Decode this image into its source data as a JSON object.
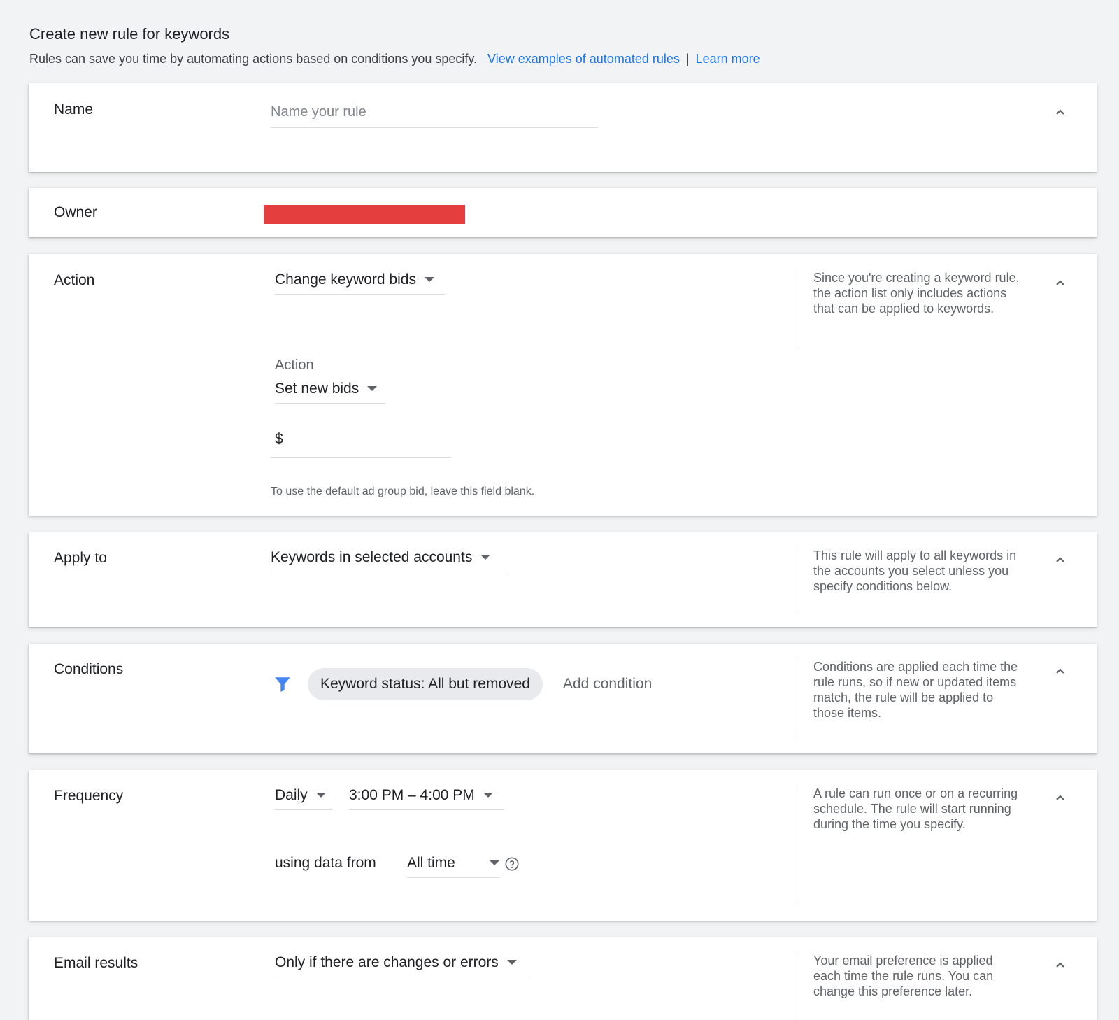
{
  "header": {
    "title": "Create new rule for keywords",
    "subtitle": "Rules can save you time by automating actions based on conditions you specify.",
    "link_examples": "View examples of automated rules",
    "separator": "|",
    "link_learn": "Learn more"
  },
  "name_card": {
    "label": "Name",
    "placeholder": "Name your rule",
    "value": ""
  },
  "owner_card": {
    "label": "Owner",
    "redaction_color": "#e53e3e"
  },
  "action_card": {
    "label": "Action",
    "action_select": "Change keyword bids",
    "sub_label": "Action",
    "bid_select": "Set new bids",
    "currency_symbol": "$",
    "bid_value": "",
    "hint": "To use the default ad group bid, leave this field blank.",
    "help": "Since you're creating a keyword rule, the action list only includes actions that can be applied to keywords."
  },
  "apply_card": {
    "label": "Apply to",
    "select": "Keywords in selected accounts",
    "help": "This rule will apply to all keywords in the accounts you select unless you specify conditions below."
  },
  "conditions_card": {
    "label": "Conditions",
    "filter_icon": "filter-icon",
    "chip": "Keyword status: All but removed",
    "add": "Add condition",
    "help": "Conditions are applied each time the rule runs, so if new or updated items match, the rule will be applied to those items."
  },
  "frequency_card": {
    "label": "Frequency",
    "frequency_select": "Daily",
    "time_select": "3:00 PM – 4:00 PM",
    "data_label": "using data from",
    "data_select": "All time",
    "help_icon": "help-circle-icon",
    "help": "A rule can run once or on a recurring schedule. The rule will start running during the time you specify."
  },
  "email_card": {
    "label": "Email results",
    "select": "Only if there are changes or errors",
    "help": "Your email preference is applied each time the rule runs. You can change this preference later."
  },
  "colors": {
    "accent": "#1a73e8",
    "filter_icon": "#4285f4"
  }
}
